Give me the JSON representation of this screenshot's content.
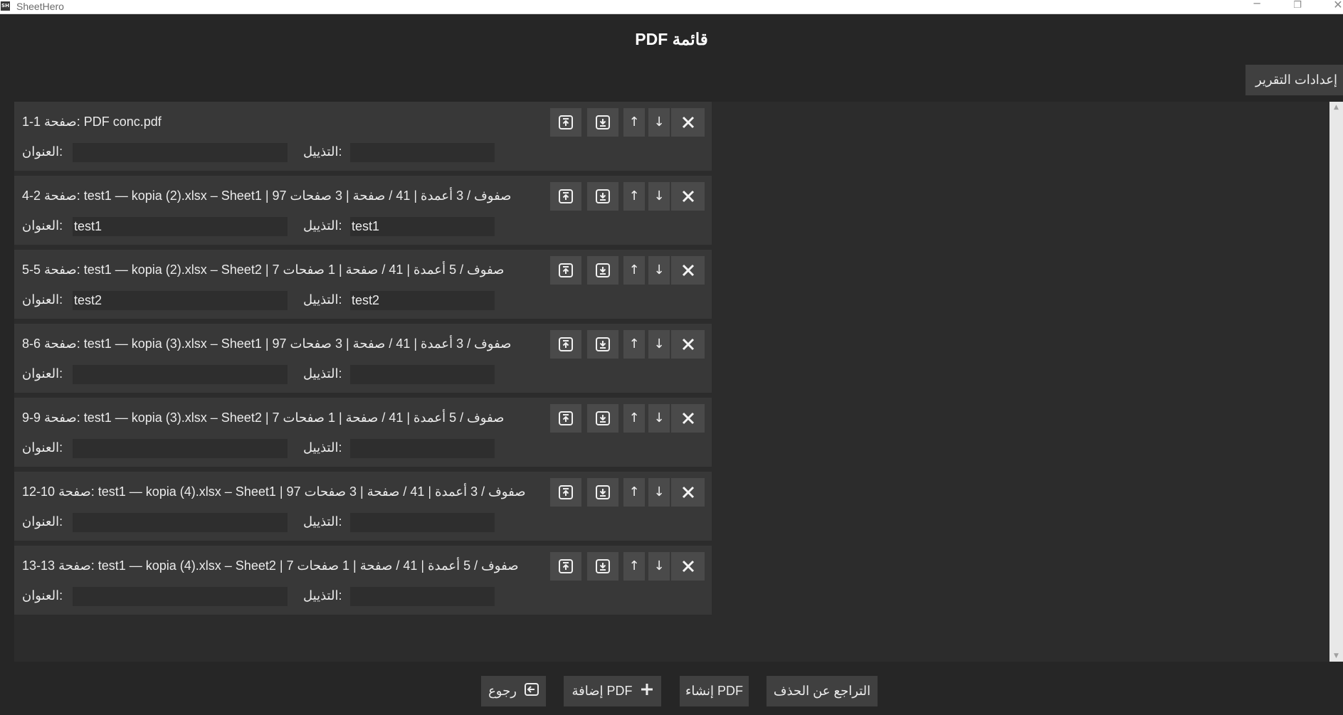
{
  "window": {
    "app_title": "SheetHero",
    "logo_text": "SH",
    "minimize_glyph": "─",
    "maximize_glyph": "❐",
    "close_glyph": "✕"
  },
  "page_title": "PDF قائمة",
  "report_settings_label": "إعدادات التقرير",
  "field_labels": {
    "title": "العنوان:",
    "footer": "التذييل:"
  },
  "controls": {
    "up_glyph": "↑",
    "down_glyph": "↓"
  },
  "entries": [
    {
      "label": "صفحة 1-1: PDF conc.pdf",
      "title_value": "",
      "footer_value": ""
    },
    {
      "label": "صفحة 2-4: test1 — kopia (2).xlsx – Sheet1 | 97 صفوف / 3 أعمدة | 41 / صفحة | 3 صفحات",
      "title_value": "test1",
      "footer_value": "test1"
    },
    {
      "label": "صفحة 5-5: test1 — kopia (2).xlsx – Sheet2 | 7 صفوف / 5 أعمدة | 41 / صفحة | 1 صفحات",
      "title_value": "test2",
      "footer_value": "test2"
    },
    {
      "label": "صفحة 6-8: test1 — kopia (3).xlsx – Sheet1 | 97 صفوف / 3 أعمدة | 41 / صفحة | 3 صفحات",
      "title_value": "",
      "footer_value": ""
    },
    {
      "label": "صفحة 9-9: test1 — kopia (3).xlsx – Sheet2 | 7 صفوف / 5 أعمدة | 41 / صفحة | 1 صفحات",
      "title_value": "",
      "footer_value": ""
    },
    {
      "label": "صفحة 10-12: test1 — kopia (4).xlsx – Sheet1 | 97 صفوف / 3 أعمدة | 41 / صفحة | 3 صفحات",
      "title_value": "",
      "footer_value": ""
    },
    {
      "label": "صفحة 13-13: test1 — kopia (4).xlsx – Sheet2 | 7 صفوف / 5 أعمدة | 41 / صفحة | 1 صفحات",
      "title_value": "",
      "footer_value": ""
    }
  ],
  "bottom_buttons": {
    "back": "رجوع",
    "add_pdf": "إضافة PDF",
    "make_pdf": "إنشاء PDF",
    "undo_delete": "التراجع عن الحذف"
  },
  "icons": {
    "move_top": "move-to-top-icon",
    "move_bottom": "move-to-bottom-icon",
    "delete": "close-icon",
    "back": "back-arrow-icon",
    "add": "plus-icon"
  }
}
